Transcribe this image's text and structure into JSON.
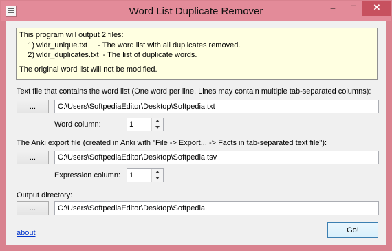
{
  "window": {
    "title": "Word List Duplicate Remover",
    "icons": {
      "app": "app-icon",
      "minimize": "minimize-icon",
      "maximize": "maximize-icon",
      "close": "close-icon"
    },
    "controls": {
      "minimize": "–",
      "maximize": "□",
      "close": "✕"
    },
    "colors": {
      "frame": "#d9828f",
      "close_button": "#c7515f",
      "info_box": "#ffffe1",
      "link": "#0033cc"
    }
  },
  "info": {
    "line1": "This program will output 2 files:",
    "line2": "    1) wldr_unique.txt     - The word list with all duplicates removed.",
    "line3": "    2) wldr_duplicates.txt  - The list of duplicate words.",
    "line4": "The original word list will not be modified."
  },
  "wordlist": {
    "label": "Text file that contains the word list (One word per line. Lines may contain multiple tab-separated columns):",
    "browse_label": "...",
    "path": "C:\\Users\\SoftpediaEditor\\Desktop\\Softpedia.txt",
    "column_label": "Word column:",
    "column_value": "1"
  },
  "anki": {
    "label": "The Anki export file (created in Anki with \"File -> Export... -> Facts in tab-separated text file\"):",
    "browse_label": "...",
    "path": "C:\\Users\\SoftpediaEditor\\Desktop\\Softpedia.tsv",
    "column_label": "Expression column:",
    "column_value": "1"
  },
  "output": {
    "label": "Output directory:",
    "browse_label": "...",
    "path": "C:\\Users\\SoftpediaEditor\\Desktop\\Softpedia"
  },
  "footer": {
    "about_link": "about",
    "go_label": "Go!"
  }
}
